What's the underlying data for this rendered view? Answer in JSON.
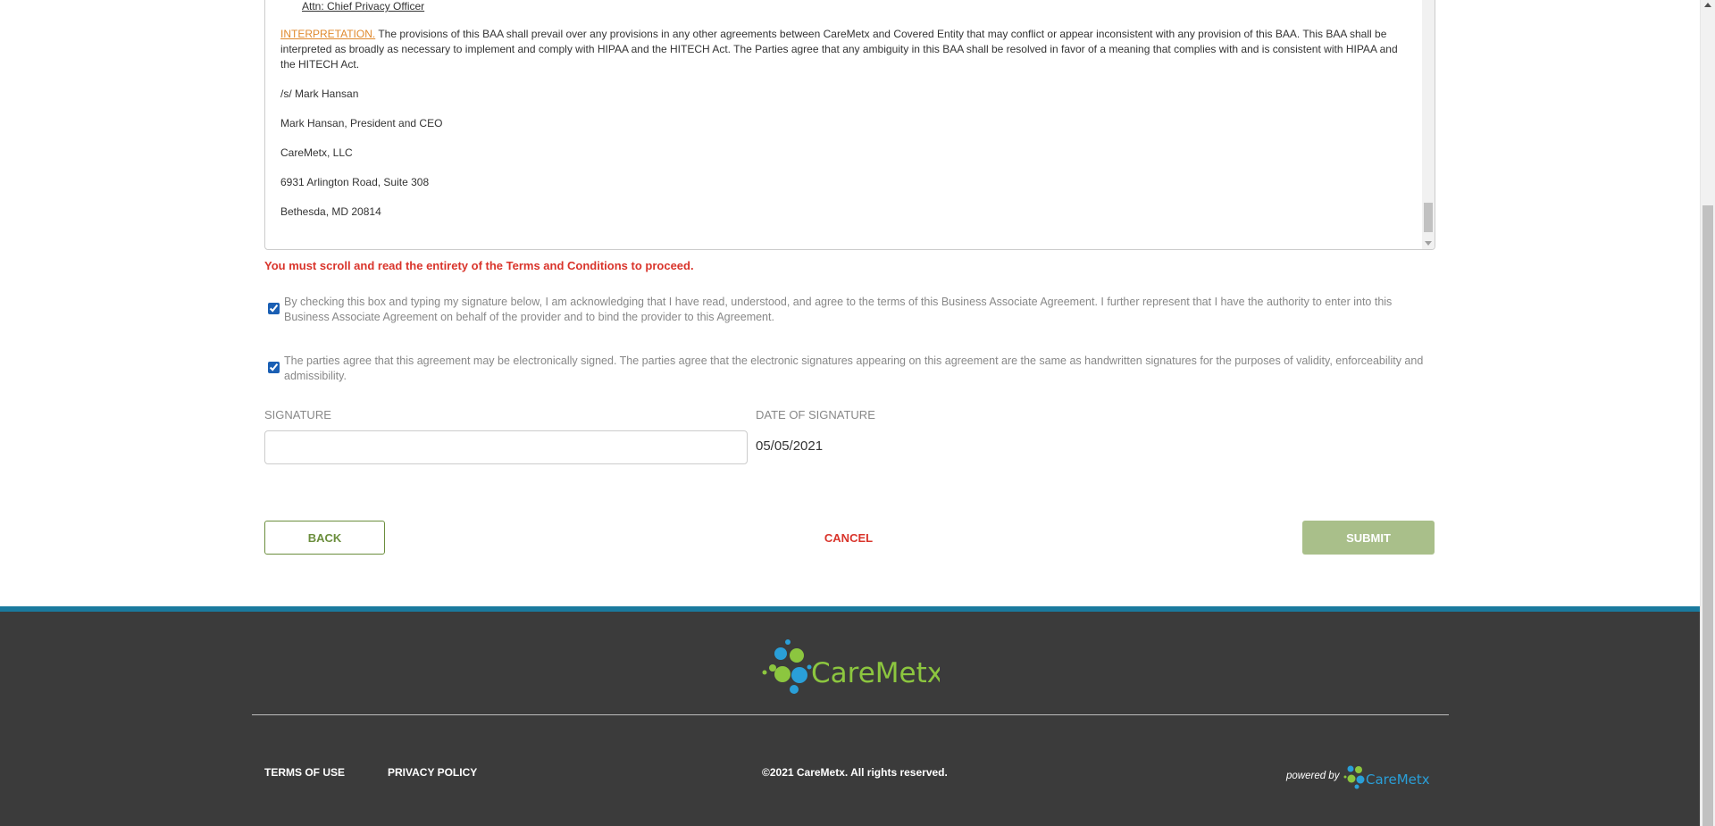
{
  "terms": {
    "attn": "Attn: Chief Privacy Officer",
    "interpretation_heading": "INTERPRETATION.",
    "interpretation_text": " The provisions of this BAA shall prevail over any provisions in any other agreements between CareMetx and Covered Entity that may conflict or appear inconsistent with any provision of this BAA. This BAA shall be interpreted as broadly as necessary to implement and comply with HIPAA and the HITECH Act. The Parties agree that any ambiguity in this BAA shall be resolved in favor of a meaning that complies with and is consistent with HIPAA and the HITECH Act.",
    "signature_lines": [
      "/s/ Mark Hansan",
      "Mark Hansan, President and CEO",
      "CareMetx, LLC",
      "6931 Arlington Road, Suite 308",
      "Bethesda, MD 20814"
    ]
  },
  "warning": "You must scroll and read the entirety of the Terms and Conditions to proceed.",
  "checkboxes": [
    {
      "checked": true,
      "text": "By checking this box and typing my signature below, I am acknowledging that I have read, understood, and agree to the terms of this Business Associate Agreement. I further represent that I have the authority to enter into this Business Associate Agreement on behalf of the provider and to bind the provider to this Agreement."
    },
    {
      "checked": true,
      "text": "The parties agree that this agreement may be electronically signed. The parties agree that the electronic signatures appearing on this agreement are the same as handwritten signatures for the purposes of validity, enforceability and admissibility."
    }
  ],
  "signature": {
    "label": "SIGNATURE",
    "value": "",
    "date_label": "DATE OF SIGNATURE",
    "date_value": "05/05/2021"
  },
  "buttons": {
    "back": "BACK",
    "cancel": "CANCEL",
    "submit": "SUBMIT"
  },
  "footer": {
    "brand": "CareMetx",
    "terms_link": "TERMS OF USE",
    "privacy_link": "PRIVACY POLICY",
    "copyright": "©2021 CareMetx. All rights reserved.",
    "powered_by": "powered by"
  },
  "colors": {
    "accent_green": "#6b8e3d",
    "submit_green": "#a9bf8a",
    "warning_red": "#d9342b",
    "footer_bg": "#3b3b3b",
    "footer_stripe": "#1a7a9e",
    "brand_blue": "#2a9fd8",
    "brand_green": "#8cc63f"
  }
}
